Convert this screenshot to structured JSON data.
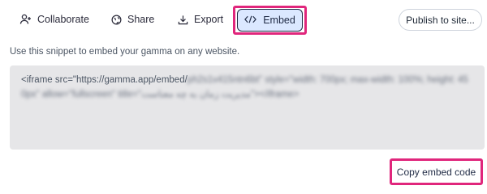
{
  "tabs": {
    "collaborate": "Collaborate",
    "share": "Share",
    "export": "Export",
    "embed": "Embed"
  },
  "publish_label": "Publish to site...",
  "description": "Use this snippet to embed your gamma on any website.",
  "snippet": {
    "visible_prefix": "<iframe src=\"https://gamma.app/embed/",
    "blurred_rest": "ph2s1v415ntn6bt\" style=\"width: 700px; max-width: 100%; height: 450px\" allow=\"fullscreen\" title=\"مدیریت زمان به چه معناست\"></iframe>"
  },
  "copy_label": "Copy embed code",
  "colors": {
    "highlight": "#e0267c",
    "embed_active_bg": "#dbe8ff",
    "snippet_bg": "#e6e6e8"
  }
}
